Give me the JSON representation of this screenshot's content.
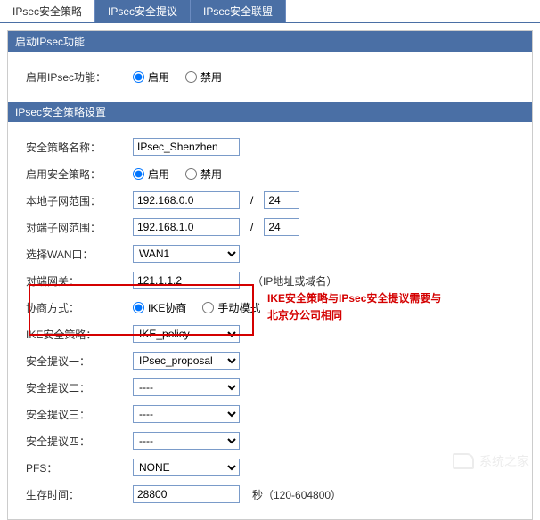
{
  "tabs": {
    "policy": "IPsec安全策略",
    "proposal": "IPsec安全提议",
    "sa": "IPsec安全联盟"
  },
  "section1": {
    "title": "启动IPsec功能",
    "enableLabel": "启用IPsec功能：",
    "enable": "启用",
    "disable": "禁用"
  },
  "section2": {
    "title": "IPsec安全策略设置",
    "policyNameLabel": "安全策略名称：",
    "policyName": "IPsec_Shenzhen",
    "enablePolicyLabel": "启用安全策略：",
    "enable": "启用",
    "disable": "禁用",
    "localSubnetLabel": "本地子网范围：",
    "localSubnetIp": "192.168.0.0",
    "localSubnetMask": "24",
    "remoteSubnetLabel": "对端子网范围：",
    "remoteSubnetIp": "192.168.1.0",
    "remoteSubnetMask": "24",
    "wanLabel": "选择WAN口：",
    "wanValue": "WAN1",
    "gatewayLabel": "对端网关：",
    "gatewayValue": "121.1.1.2",
    "gatewayNote": "（IP地址或域名）",
    "negotiationLabel": "协商方式：",
    "ikeMode": "IKE协商",
    "manualMode": "手动模式",
    "ikePolicyLabel": "IKE安全策略：",
    "ikePolicyValue": "IKE_policy",
    "proposal1Label": "安全提议一：",
    "proposal1Value": "IPsec_proposal",
    "proposal2Label": "安全提议二：",
    "proposal2Value": "----",
    "proposal3Label": "安全提议三：",
    "proposal3Value": "----",
    "proposal4Label": "安全提议四：",
    "proposal4Value": "----",
    "pfsLabel": "PFS：",
    "pfsValue": "NONE",
    "lifetimeLabel": "生存时间：",
    "lifetimeValue": "28800",
    "lifetimeNote": "秒（120-604800）"
  },
  "annotation": "IKE安全策略与IPsec安全提议需要与北京分公司相同",
  "watermark": "系统之家"
}
